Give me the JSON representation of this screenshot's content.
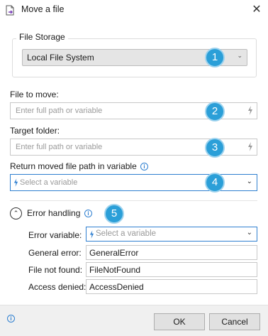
{
  "window": {
    "title": "Move a file"
  },
  "file_storage": {
    "legend": "File Storage",
    "selected": "Local File System"
  },
  "file_to_move": {
    "label": "File to move:",
    "placeholder": "Enter full path or variable"
  },
  "target_folder": {
    "label": "Target folder:",
    "placeholder": "Enter full path or variable"
  },
  "return_var": {
    "label": "Return moved file path in variable",
    "placeholder": "Select a variable"
  },
  "error_handling": {
    "title": "Error handling",
    "error_variable": {
      "label": "Error variable:",
      "placeholder": "Select a variable"
    },
    "general_error": {
      "label": "General error:",
      "value": "GeneralError"
    },
    "file_not_found": {
      "label": "File not found:",
      "value": "FileNotFound"
    },
    "access_denied": {
      "label": "Access denied:",
      "value": "AccessDenied"
    }
  },
  "badges": [
    "1",
    "2",
    "3",
    "4",
    "5"
  ],
  "buttons": {
    "ok": "OK",
    "cancel": "Cancel"
  },
  "colors": {
    "accent": "#2e7fd0",
    "badge": "#2b9fd8"
  }
}
